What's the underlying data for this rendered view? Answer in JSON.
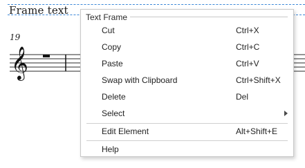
{
  "score": {
    "frame_text": "Frame text",
    "measure_number": "19"
  },
  "context_menu": {
    "section_title": "Text Frame",
    "items": [
      {
        "label": "Cut",
        "shortcut": "Ctrl+X"
      },
      {
        "label": "Copy",
        "shortcut": "Ctrl+C"
      },
      {
        "label": "Paste",
        "shortcut": "Ctrl+V"
      },
      {
        "label": "Swap with Clipboard",
        "shortcut": "Ctrl+Shift+X"
      },
      {
        "label": "Delete",
        "shortcut": "Del"
      },
      {
        "label": "Select",
        "shortcut": ""
      },
      {
        "label": "Edit Element",
        "shortcut": "Alt+Shift+E"
      },
      {
        "label": "Help",
        "shortcut": ""
      }
    ]
  },
  "colors": {
    "frame_dash": "#3b87d8",
    "menu_border": "#c8c8c8",
    "text": "#1f1f1f"
  }
}
